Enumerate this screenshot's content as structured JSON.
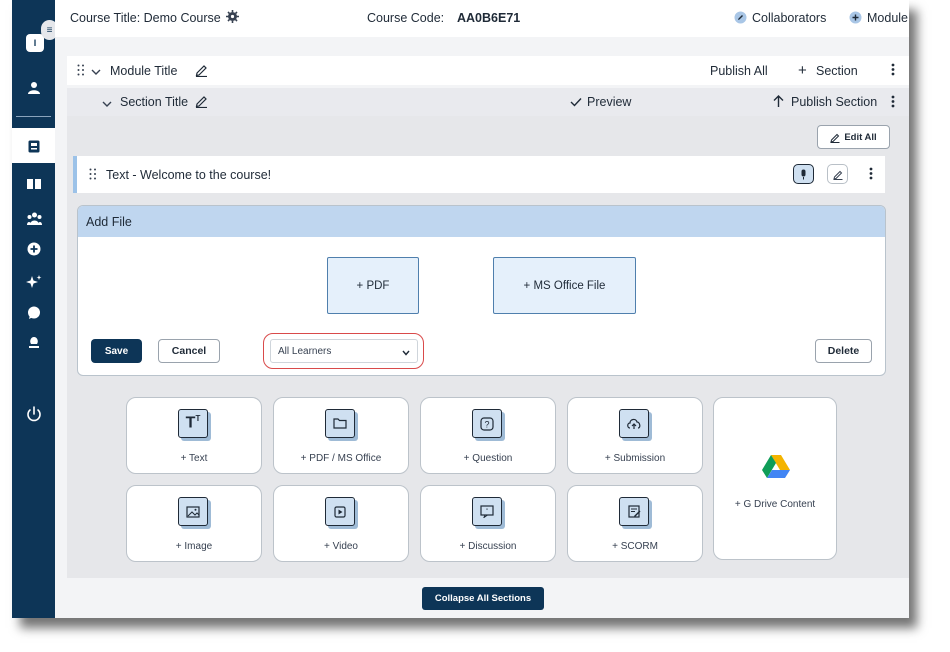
{
  "topbar": {
    "course_title": "Course Title: Demo Course",
    "course_code_label": "Course Code:",
    "course_code": "AA0B6E71",
    "collaborators": "Collaborators",
    "module": "Module"
  },
  "sidebar": {
    "avatar_initial": "I",
    "items": [
      "user-icon",
      "gradebook-icon",
      "book-icon",
      "people-icon",
      "add-icon",
      "sparkle-icon",
      "chat-icon",
      "lamp-icon",
      "power-icon"
    ]
  },
  "module_row": {
    "title": "Module Title",
    "publish_all": "Publish All",
    "section": "Section"
  },
  "section_row": {
    "title": "Section Title",
    "preview": "Preview",
    "publish_section": "Publish Section"
  },
  "edit_all": "Edit All",
  "text_block": {
    "title": "Text - Welcome to the course!"
  },
  "add_file": {
    "header": "Add File",
    "pdf": "+ PDF",
    "ms_office": "+ MS Office File",
    "save": "Save",
    "cancel": "Cancel",
    "audience": "All Learners",
    "delete": "Delete"
  },
  "content_types": {
    "text": "+ Text",
    "pdf_office": "+ PDF / MS Office",
    "question": "+ Question",
    "submission": "+ Submission",
    "image": "+ Image",
    "video": "+ Video",
    "discussion": "+ Discussion",
    "scorm": "+ SCORM",
    "gdrive": "+ G Drive Content"
  },
  "collapse_all": "Collapse All Sections",
  "colors": {
    "navy": "#0d3557",
    "accent_blue": "#bfd6ef",
    "danger_outline": "#d94a4a"
  }
}
